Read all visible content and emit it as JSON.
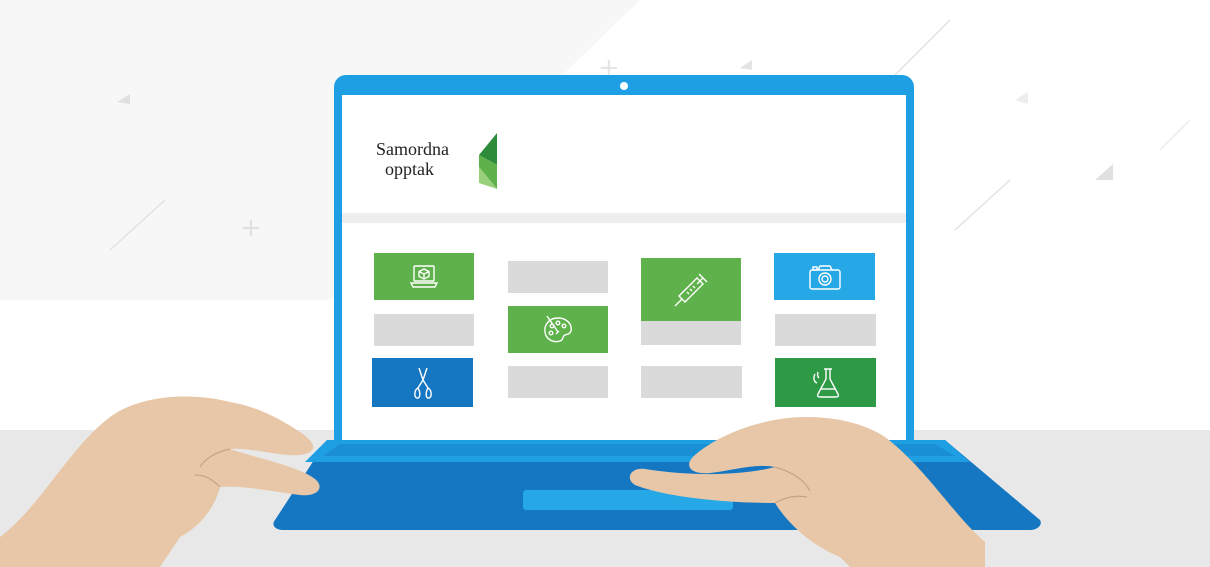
{
  "brand": {
    "line1": "Samordna",
    "line2": "opptak",
    "logo_colors": [
      "#2e8b3a",
      "#5fb14b",
      "#9bd07b"
    ]
  },
  "colors": {
    "laptop_blue": "#1e9ee3",
    "laptop_dark": "#1577c2",
    "tile_green": "#5fb14b",
    "tile_dark_green": "#2e9a45",
    "tile_blue": "#1577c2",
    "tile_light_blue": "#26a8e6",
    "tile_gray": "#dadada",
    "skin": "#e8c7a8"
  },
  "tiles": [
    {
      "icon": "laptop-cube-icon",
      "color": "#5fb14b"
    },
    {
      "icon": "palette-icon",
      "color": "#5fb14b"
    },
    {
      "icon": "syringe-icon",
      "color": "#5fb14b"
    },
    {
      "icon": "camera-icon",
      "color": "#26a8e6"
    },
    {
      "icon": "pruning-shears-icon",
      "color": "#1577c2"
    },
    {
      "icon": "chemistry-flask-icon",
      "color": "#2e9a45"
    }
  ]
}
